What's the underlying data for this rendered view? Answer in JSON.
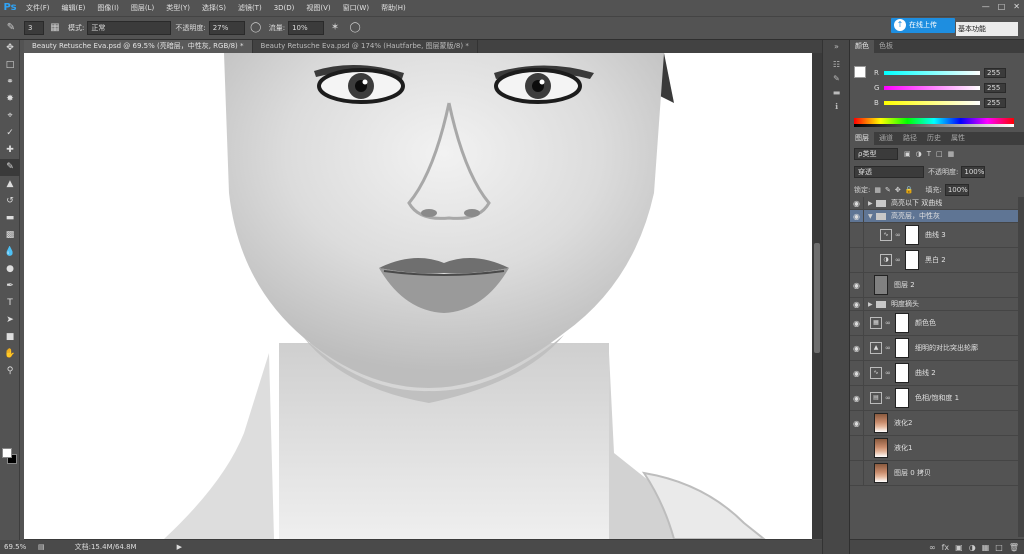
{
  "app": {
    "logo": "Ps"
  },
  "menu": [
    "文件(F)",
    "编辑(E)",
    "图像(I)",
    "图层(L)",
    "类型(Y)",
    "选择(S)",
    "滤镜(T)",
    "3D(D)",
    "视图(V)",
    "窗口(W)",
    "帮助(H)"
  ],
  "options": {
    "brush_size": "3",
    "mode_label": "模式:",
    "mode_value": "正常",
    "opacity_label": "不透明度:",
    "opacity_value": "27%",
    "flow_label": "流量:",
    "flow_value": "10%"
  },
  "sync_button": "在线上传",
  "workspace": "基本功能",
  "doc_tabs": [
    "Beauty Retusche Eva.psd @ 69.5% (亮暗层，中性灰, RGB/8) *",
    "Beauty Retusche Eva.psd @ 174% (Hautfarbe, 图层蒙版/8) *"
  ],
  "status": {
    "zoom": "69.5%",
    "doc_info": "文档:15.4M/64.8M"
  },
  "color_panel": {
    "tabs": [
      "颜色",
      "色板"
    ],
    "r_label": "R",
    "g_label": "G",
    "b_label": "B",
    "r": "255",
    "g": "255",
    "b": "255"
  },
  "layers_panel": {
    "tabs": [
      "图层",
      "通道",
      "路径",
      "历史",
      "属性"
    ],
    "kind_label": "ρ类型",
    "blend_mode": "穿透",
    "opacity_label": "不透明度:",
    "opacity_value": "100%",
    "lock_label": "锁定:",
    "fill_label": "填充:",
    "fill_value": "100%",
    "layers": [
      {
        "name": "高亮以下 双曲线"
      },
      {
        "name": "高亮层，中性灰"
      },
      {
        "name": "曲线 3"
      },
      {
        "name": "黑白 2"
      },
      {
        "name": "图层 2"
      },
      {
        "name": "明度摘头"
      },
      {
        "name": "颜色色"
      },
      {
        "name": "细明的对比突出轮廓"
      },
      {
        "name": "曲线 2"
      },
      {
        "name": "色相/饱和度 1"
      },
      {
        "name": "液化2"
      },
      {
        "name": "液化1"
      },
      {
        "name": "图层 0 拷贝"
      }
    ]
  }
}
